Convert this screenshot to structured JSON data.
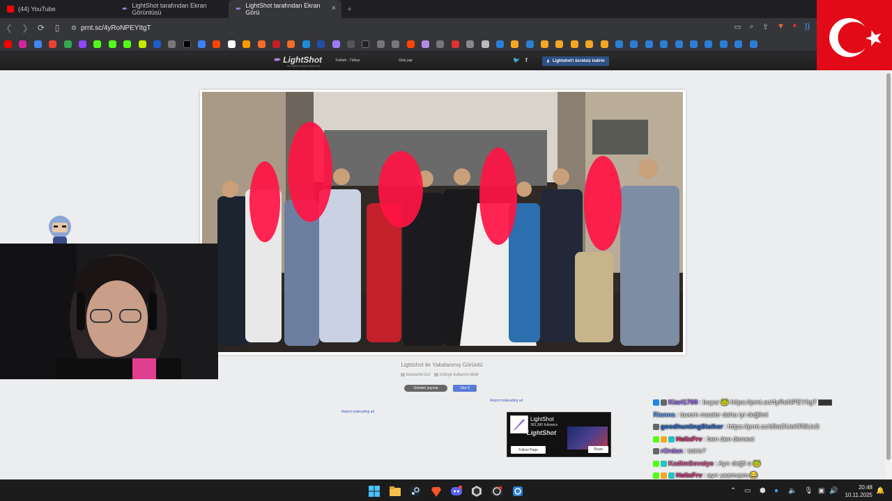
{
  "browser": {
    "tabs": [
      {
        "label": "(44) YouTube",
        "active": false
      },
      {
        "label": "LightShot tarafından Ekran Görüntüsü",
        "active": false
      },
      {
        "label": "LightShot tarafından Ekran Görü",
        "active": true
      }
    ],
    "close_glyph": "×",
    "new_tab_glyph": "+",
    "url": "prnt.sc/4yRoNPEYItgT"
  },
  "lightshot": {
    "logo": "LightShot",
    "tagline": "the fastest screenshot tool",
    "language": "Turkish - Türkçe",
    "login": "Giriş yap",
    "download_button": "Lightshot'ı ücretsiz indirin",
    "caption": "Lightshot ile Yakalanmış Görüntü",
    "link_similar": "benzerini bul",
    "link_report": "kötüye kullanım bildir",
    "tweet_button": "Gönderi yayınla",
    "like_button": "Like 0",
    "report_ad_1": "Report misleading ad",
    "report_ad_2": "Report misleading ad",
    "fb": {
      "name": "LightShot",
      "followers": "383,380 followers",
      "brand": "LightShot",
      "follow": "Follow Page",
      "share": "Share"
    }
  },
  "chat": [
    {
      "user": "Kiari1709",
      "color": "#a070ff",
      "text": ": buyur",
      "link": "https://prnt.sc/4yRoNPEYItgT"
    },
    {
      "user": "Rianna",
      "color": "#6aa6ff",
      "text": ": tavern master daha iyi değilmi",
      "link": ""
    },
    {
      "user": "goodhuntingStalker",
      "color": "#2b6fd6",
      "text": ":",
      "link": "https://prnt.sc/d9aOUoKR8UxS"
    },
    {
      "user": "HelixFrv",
      "color": "#e0307a",
      "text": ": ben den demesi",
      "link": ""
    },
    {
      "user": "rOrdan",
      "color": "#b07cff",
      "text": ": tetris?",
      "link": ""
    },
    {
      "user": "KadimSovalye",
      "color": "#e05a9a",
      "text": ": Ayrı değil o",
      "link": ""
    },
    {
      "user": "HelixFrv",
      "color": "#e0307a",
      "text": ": ayrı yazmışım",
      "link": ""
    }
  ],
  "taskbar": {
    "time": "20:48",
    "date": "10.11.2025"
  }
}
